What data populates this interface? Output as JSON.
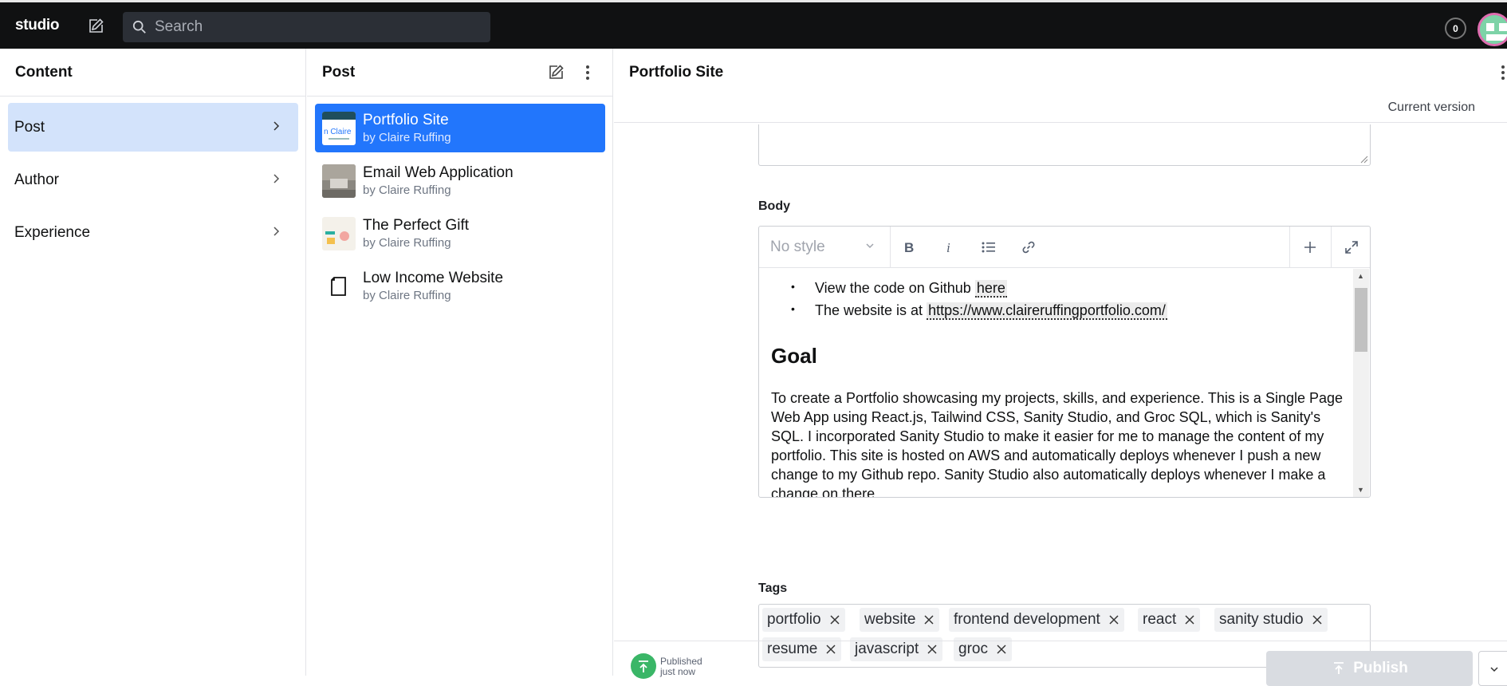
{
  "app": {
    "logo": "studio"
  },
  "search": {
    "placeholder": "Search"
  },
  "notifications": {
    "count": "0"
  },
  "content_pane": {
    "title": "Content",
    "items": [
      {
        "label": "Post",
        "active": true
      },
      {
        "label": "Author",
        "active": false
      },
      {
        "label": "Experience",
        "active": false
      }
    ]
  },
  "post_pane": {
    "title": "Post",
    "documents": [
      {
        "title": "Portfolio Site",
        "subtitle": "by Claire Ruffing"
      },
      {
        "title": "Email Web Application",
        "subtitle": "by Claire Ruffing"
      },
      {
        "title": "The Perfect Gift",
        "subtitle": "by Claire Ruffing"
      },
      {
        "title": "Low Income Website",
        "subtitle": "by Claire Ruffing"
      }
    ]
  },
  "editor_pane": {
    "title": "Portfolio Site",
    "version": "Current version",
    "body": {
      "label": "Body",
      "style_select": "No style",
      "bullet1_prefix": "View the code on Github ",
      "bullet1_link": "here",
      "bullet2_prefix": "The website is at ",
      "bullet2_link": "https://www.claireruffingportfolio.com/",
      "heading": "Goal",
      "paragraph": "To create a Portfolio showcasing my projects, skills, and experience. This is a Single Page Web App using React.js, Tailwind CSS, Sanity Studio, and Groc SQL, which is Sanity's SQL. I incorporated Sanity Studio to make it easier for me to manage the content of my portfolio. This site is hosted on AWS and automatically deploys whenever I push a new change to my Github repo. Sanity Studio also automatically deploys whenever I make a change on there."
    },
    "tags": {
      "label": "Tags",
      "items": [
        "portfolio",
        "website",
        "frontend development",
        "react",
        "sanity studio",
        "resume",
        "javascript",
        "groc"
      ]
    },
    "footer": {
      "status": "Published",
      "status_time": "just now",
      "publish_label": "Publish"
    }
  }
}
